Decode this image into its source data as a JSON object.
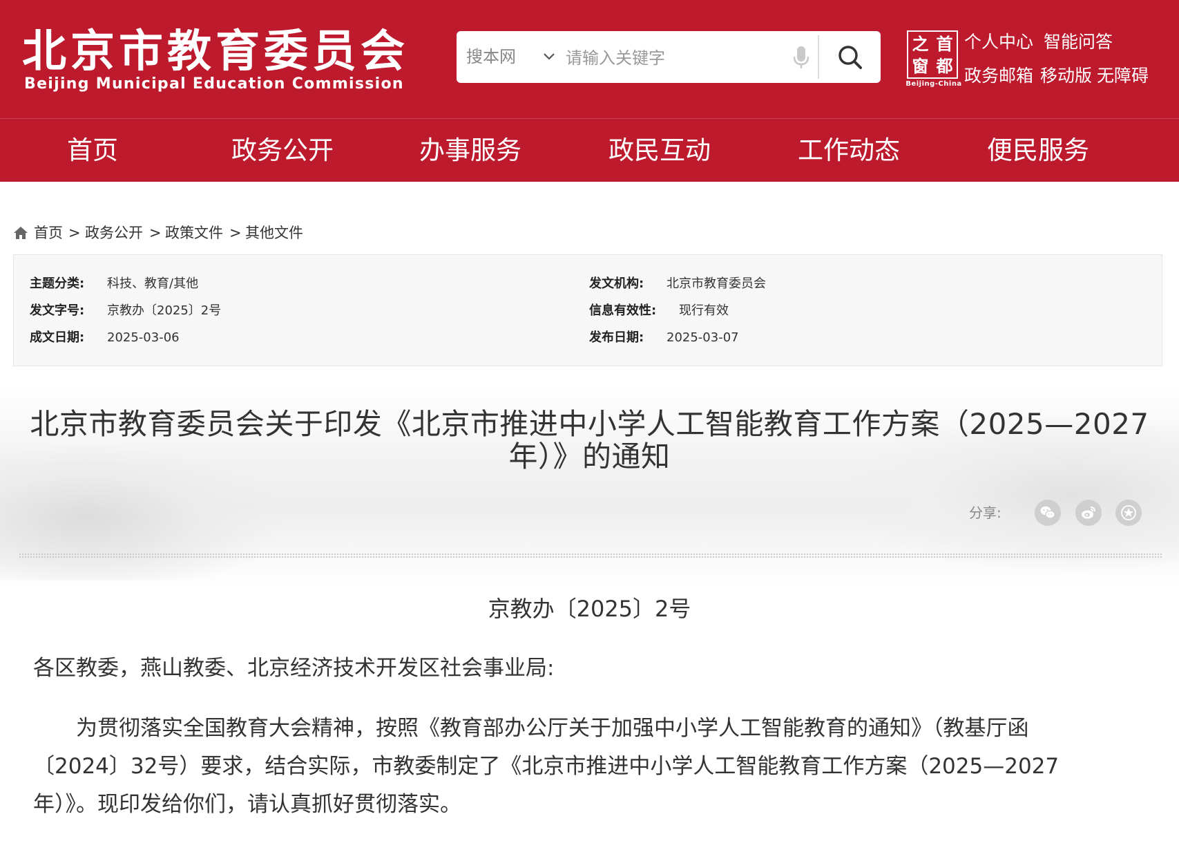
{
  "header": {
    "logo_cn": "北京市教育委员会",
    "logo_en": "Beijing Municipal Education Commission",
    "search": {
      "scope": "搜本网",
      "placeholder": "请输入关键字"
    },
    "seal": {
      "chars": [
        "之",
        "首",
        "窗",
        "都"
      ],
      "caption": "Beijing-China"
    },
    "links": [
      "个人中心",
      "智能问答",
      "政务邮箱",
      "移动版",
      "无障碍"
    ]
  },
  "nav": [
    "首页",
    "政务公开",
    "办事服务",
    "政民互动",
    "工作动态",
    "便民服务"
  ],
  "breadcrumb": {
    "items": [
      "首页",
      "政务公开",
      "政策文件",
      "其他文件"
    ],
    "separator": ">"
  },
  "meta": {
    "topic_label": "主题分类:",
    "topic": "科技、教育/其他",
    "issuer_label": "发文机构:",
    "issuer": "北京市教育委员会",
    "docno_label": "发文字号:",
    "docno": "京教办〔2025〕2号",
    "validity_label": "信息有效性:",
    "validity": "现行有效",
    "written_label": "成文日期:",
    "written": "2025-03-06",
    "published_label": "发布日期:",
    "published": "2025-03-07"
  },
  "article": {
    "title_line1": "北京市教育委员会关于印发《北京市推进中小学人工智能教育工作方案（2025—2027",
    "title_line2": "年）》的通知",
    "share_label": "分享:",
    "doc_number": "京教办〔2025〕2号",
    "addressee": "各区教委，燕山教委、北京经济技术开发区社会事业局:",
    "body": "为贯彻落实全国教育大会精神，按照《教育部办公厅关于加强中小学人工智能教育的通知》（教基厅函〔2024〕32号）要求，结合实际，市教委制定了《北京市推进中小学人工智能教育工作方案（2025—2027年）》。现印发给你们，请认真抓好贯彻落实。"
  },
  "colors": {
    "brand_red": "#bd1a2d",
    "meta_bg": "#f7f7f7"
  },
  "icons": [
    "chevron-down-icon",
    "microphone-icon",
    "search-icon",
    "home-icon",
    "wechat-icon",
    "weibo-icon",
    "favorite-icon"
  ]
}
